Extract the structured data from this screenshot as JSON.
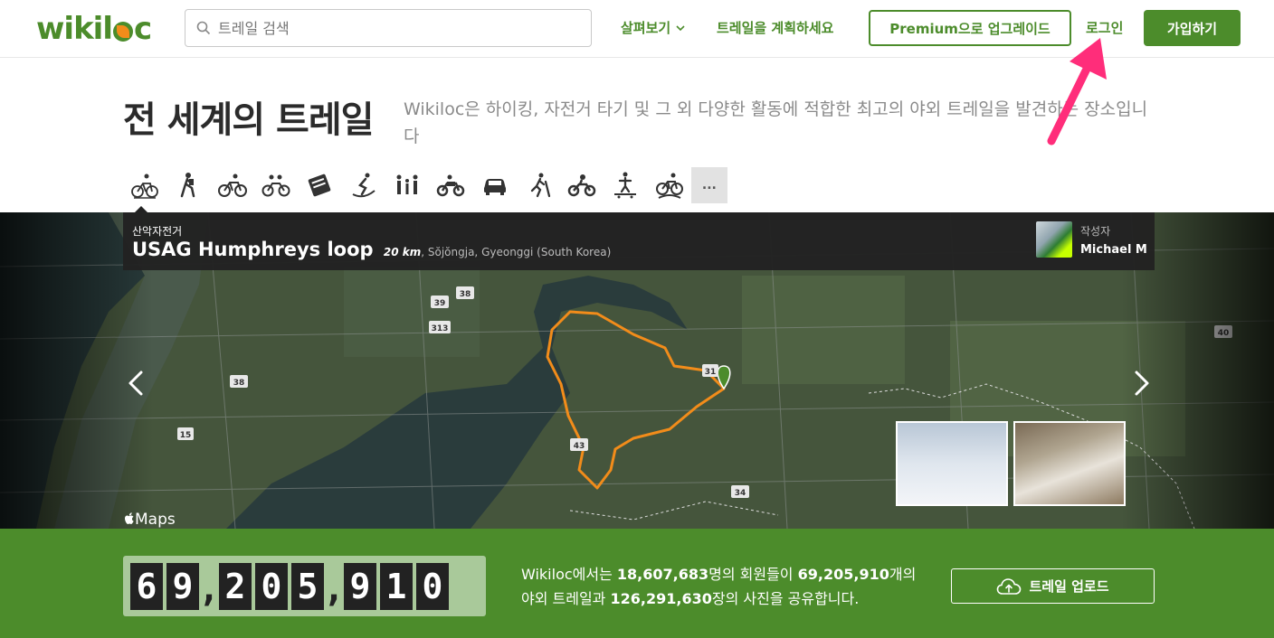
{
  "header": {
    "logo": "wikiloc",
    "search_placeholder": "트레일 검색",
    "nav_explore": "살펴보기",
    "nav_plan": "트레일을 계획하세요",
    "premium_button": "Premium으로 업그레이드",
    "login": "로그인",
    "signup_button": "가입하기"
  },
  "hero": {
    "title": "전 세계의 트레일",
    "description": "Wikiloc은 하이킹, 자전거 타기 및 그 외 다양한 활동에 적합한 최고의 야외 트레일을 발견하는 장소입니다"
  },
  "activities": {
    "icons": [
      "mountain-biking-icon",
      "hiking-icon",
      "cycling-icon",
      "tandem-bike-icon",
      "guide-book-icon",
      "skiing-icon",
      "family-walk-icon",
      "motorcycle-icon",
      "car-icon",
      "trail-running-icon",
      "dirt-bike-icon",
      "skateboard-icon",
      "bmx-icon"
    ],
    "more_label": "..."
  },
  "featured_trail": {
    "activity": "산악자전거",
    "name": "USAG Humphreys loop",
    "distance": "20 km",
    "location": "Sŏjŏngja, Gyeonggi (South Korea)",
    "author_label": "작성자",
    "author_name": "Michael M",
    "map_attribution": "Maps",
    "road_markers": [
      "39",
      "38",
      "313",
      "38",
      "15",
      "40",
      "31",
      "43",
      "34"
    ]
  },
  "stats": {
    "counter_digits": [
      "6",
      "9",
      ",",
      "2",
      "0",
      "5",
      ",",
      "9",
      "1",
      "0"
    ],
    "text_prefix": "Wikiloc에서는 ",
    "members": "18,607,683",
    "text_mid1": "명의 회원들이 ",
    "trails": "69,205,910",
    "text_mid2": "개의 야외 트레일과 ",
    "photos": "126,291,630",
    "text_suffix": "장의 사진을 공유합니다.",
    "upload_button": "트레일 업로드"
  },
  "colors": {
    "brand_green": "#4c8c2b",
    "brand_orange": "#f28c1a",
    "annotation_pink": "#ff2d7a"
  }
}
